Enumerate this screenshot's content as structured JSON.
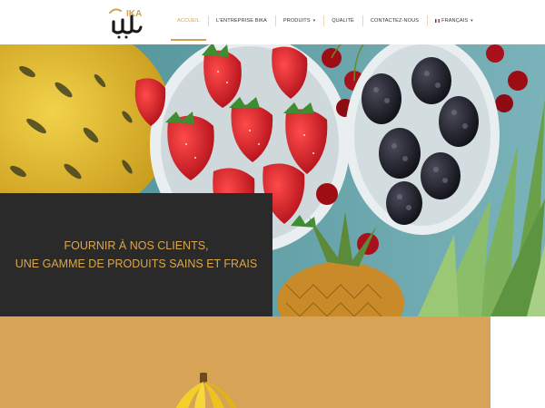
{
  "brand": {
    "logo_text_latin": "IKA",
    "logo_icon": "bika-logo-icon",
    "accent_color": "#d4a24c"
  },
  "nav": {
    "items": [
      {
        "label": "ACCUEIL",
        "active": true
      },
      {
        "label": "L'ENTREPRISE BIKA",
        "active": false
      },
      {
        "label": "PRODUITS",
        "active": false,
        "has_dropdown": true
      },
      {
        "label": "QUALITÉ",
        "active": false
      },
      {
        "label": "CONTACTEZ-NOUS",
        "active": false
      },
      {
        "label": "FRANÇAIS",
        "active": false,
        "has_dropdown": true,
        "icon": "french-flag-icon"
      }
    ]
  },
  "hero": {
    "line1": "FOURNIR À NOS CLIENTS,",
    "line2": "UNE GAMME DE PRODUITS SAINS ET FRAIS",
    "text_color": "#d9a64c",
    "box_color": "#2b2a2a"
  },
  "section": {
    "background_color": "#d6a357",
    "image_icon": "banana-image"
  }
}
